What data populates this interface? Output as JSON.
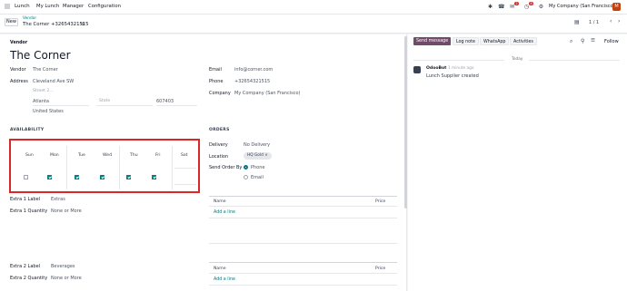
{
  "nav": {
    "app": "Lunch",
    "menu": [
      "My Lunch",
      "Manager",
      "Configuration"
    ],
    "badges": [
      "2",
      "8"
    ],
    "company": "My Company (San Francisco)",
    "avatar_initial": "M"
  },
  "control": {
    "new_label": "New",
    "breadcrumb_parent": "Vendor",
    "record_name": "The Corner +32654321515",
    "pager": "1 / 1"
  },
  "form": {
    "section_label": "Vendor",
    "title": "The Corner",
    "vendor_label": "Vendor",
    "vendor_value": "The Corner",
    "address_label": "Address",
    "street": "Cleveland Ave SW",
    "street2_placeholder": "Street 2...",
    "city": "Atlanta",
    "state_placeholder": "State",
    "zip": "607403",
    "country": "United States",
    "email_label": "Email",
    "email_value": "info@corner.com",
    "phone_label": "Phone",
    "phone_value": "+32654321515",
    "company_label": "Company",
    "company_value": "My Company (San Francisco)",
    "availability_title": "AVAILABILITY",
    "days": [
      "Sun",
      "Mon",
      "Tue",
      "Wed",
      "Thu",
      "Fri",
      "Sat"
    ],
    "orders_title": "ORDERS",
    "delivery_label": "Delivery",
    "delivery_value": "No Delivery",
    "location_label": "Location",
    "location_tag": "HQ Gold",
    "send_order_label": "Send Order By",
    "send_phone": "Phone",
    "send_email": "Email",
    "extra1_label": "Extra 1 Label",
    "extra1_value": "Extras",
    "extra1_qty_label": "Extra 1 Quantity",
    "extra1_qty_value": "None or More",
    "extra2_label": "Extra 2 Label",
    "extra2_value": "Beverages",
    "extra2_qty_label": "Extra 2 Quantity",
    "extra2_qty_value": "None or More",
    "table_name_header": "Name",
    "table_price_header": "Price",
    "add_line": "Add a line"
  },
  "chatter": {
    "send_message": "Send message",
    "log_note": "Log note",
    "whatsapp": "WhatsApp",
    "activities": "Activities",
    "follow": "Follow",
    "date_divider": "Today",
    "author": "OdooBot",
    "time": "- 1 minute ago",
    "message": "Lunch Supplier created"
  },
  "colors": {
    "accent": "#017e84",
    "brand": "#714b67",
    "highlight": "#dc2626"
  }
}
